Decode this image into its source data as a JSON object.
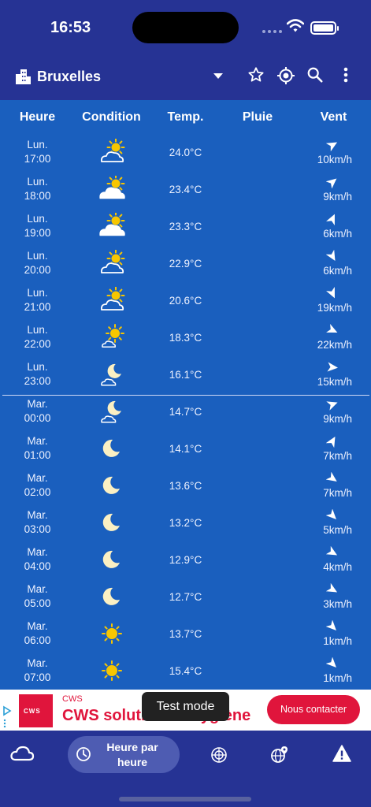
{
  "status": {
    "time": "16:53"
  },
  "app_bar": {
    "city": "Bruxelles"
  },
  "table": {
    "headers": {
      "hour": "Heure",
      "condition": "Condition",
      "temp": "Temp.",
      "rain": "Pluie",
      "wind": "Vent"
    },
    "rows": [
      {
        "day": "Lun.",
        "time": "17:00",
        "icon": "sun-cloud-icon",
        "temp": "24.0°C",
        "wind": "10km/h",
        "wind_dir_deg": 60
      },
      {
        "day": "Lun.",
        "time": "18:00",
        "icon": "cloud-sun-icon",
        "temp": "23.4°C",
        "wind": "9km/h",
        "wind_dir_deg": 50
      },
      {
        "day": "Lun.",
        "time": "19:00",
        "icon": "cloud-sun-icon",
        "temp": "23.3°C",
        "wind": "6km/h",
        "wind_dir_deg": 25
      },
      {
        "day": "Lun.",
        "time": "20:00",
        "icon": "sun-cloud-icon",
        "temp": "22.9°C",
        "wind": "6km/h",
        "wind_dir_deg": 150
      },
      {
        "day": "Lun.",
        "time": "21:00",
        "icon": "sun-cloud-icon",
        "temp": "20.6°C",
        "wind": "19km/h",
        "wind_dir_deg": 155
      },
      {
        "day": "Lun.",
        "time": "22:00",
        "icon": "sun-small-cloud-icon",
        "temp": "18.3°C",
        "wind": "22km/h",
        "wind_dir_deg": 115
      },
      {
        "day": "Lun.",
        "time": "23:00",
        "icon": "moon-cloud-icon",
        "temp": "16.1°C",
        "wind": "15km/h",
        "wind_dir_deg": 95
      },
      {
        "day": "Mar.",
        "time": "00:00",
        "icon": "moon-cloud-icon",
        "temp": "14.7°C",
        "wind": "9km/h",
        "wind_dir_deg": 70
      },
      {
        "day": "Mar.",
        "time": "01:00",
        "icon": "moon-icon",
        "temp": "14.1°C",
        "wind": "7km/h",
        "wind_dir_deg": 30
      },
      {
        "day": "Mar.",
        "time": "02:00",
        "icon": "moon-icon",
        "temp": "13.6°C",
        "wind": "7km/h",
        "wind_dir_deg": 125
      },
      {
        "day": "Mar.",
        "time": "03:00",
        "icon": "moon-icon",
        "temp": "13.2°C",
        "wind": "5km/h",
        "wind_dir_deg": 135
      },
      {
        "day": "Mar.",
        "time": "04:00",
        "icon": "moon-icon",
        "temp": "12.9°C",
        "wind": "4km/h",
        "wind_dir_deg": 120
      },
      {
        "day": "Mar.",
        "time": "05:00",
        "icon": "moon-icon",
        "temp": "12.7°C",
        "wind": "3km/h",
        "wind_dir_deg": 120
      },
      {
        "day": "Mar.",
        "time": "06:00",
        "icon": "sun-icon",
        "temp": "13.7°C",
        "wind": "1km/h",
        "wind_dir_deg": 135
      },
      {
        "day": "Mar.",
        "time": "07:00",
        "icon": "sun-icon",
        "temp": "15.4°C",
        "wind": "1km/h",
        "wind_dir_deg": 135
      }
    ]
  },
  "ad": {
    "brand": "CWS",
    "logo_text": "CWS",
    "title": "CWS solutions d'hygiène",
    "cta": "Nous contacter"
  },
  "toast": "Test mode",
  "nav": {
    "active_label": "Heure par heure"
  },
  "colors": {
    "background": "#1a5fbe",
    "app_bar": "#263394",
    "accent": "#e0153c",
    "sun": "#f7c600",
    "moon": "#fbf0c3"
  }
}
